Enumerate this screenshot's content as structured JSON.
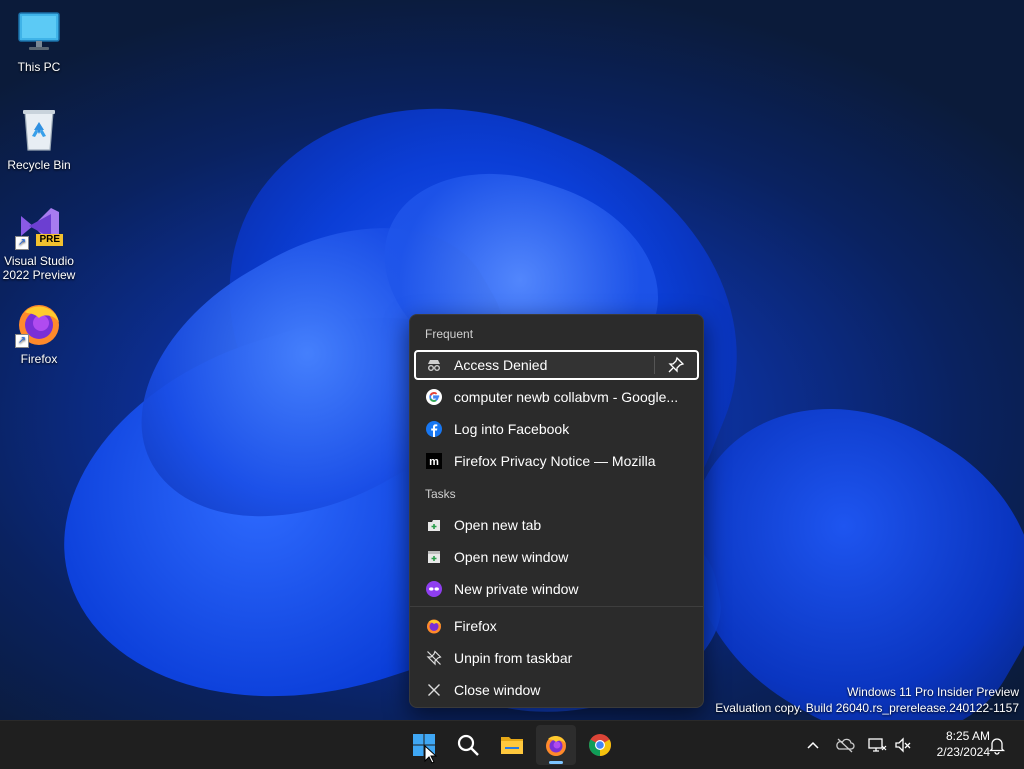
{
  "desktop": {
    "icons": [
      {
        "label": "This PC",
        "icon": "monitor-icon"
      },
      {
        "label": "Recycle Bin",
        "icon": "recycle-bin-icon"
      },
      {
        "label": "Visual Studio 2022 Preview",
        "label_line1": "Visual Studio",
        "label_line2": "2022 Preview",
        "badge": "PRE",
        "icon": "visual-studio-icon"
      },
      {
        "label": "Firefox",
        "icon": "firefox-icon"
      }
    ],
    "watermark": {
      "line1": "Windows 11 Pro Insider Preview",
      "line2": "Evaluation copy. Build 26040.rs_prerelease.240122-1157"
    }
  },
  "jumplist": {
    "frequent_header": "Frequent",
    "frequent": [
      {
        "label": "Access Denied",
        "icon": "spy-icon",
        "selected": true
      },
      {
        "label": "computer newb collabvm - Google...",
        "icon": "google-icon"
      },
      {
        "label": "Log into Facebook",
        "icon": "facebook-icon"
      },
      {
        "label": "Firefox Privacy Notice — Mozilla",
        "icon": "mozilla-icon"
      }
    ],
    "tasks_header": "Tasks",
    "tasks": [
      {
        "label": "Open new tab",
        "icon": "new-tab-icon"
      },
      {
        "label": "Open new window",
        "icon": "new-window-icon"
      },
      {
        "label": "New private window",
        "icon": "private-window-icon"
      }
    ],
    "app_actions": [
      {
        "label": "Firefox",
        "icon": "firefox-icon"
      },
      {
        "label": "Unpin from taskbar",
        "icon": "unpin-icon"
      },
      {
        "label": "Close window",
        "icon": "close-icon"
      }
    ]
  },
  "taskbar": {
    "apps": [
      "start-icon",
      "search-icon",
      "file-explorer-icon",
      "firefox-icon",
      "chrome-icon"
    ],
    "active_app": "firefox-icon",
    "clock": {
      "time": "8:25 AM",
      "date": "2/23/2024"
    },
    "tray": [
      "chevron-up-icon",
      "onedrive-icon",
      "network-icon",
      "volume-muted-icon",
      "notification-bell-icon"
    ]
  },
  "colors": {
    "accent": "#7cc4ff",
    "menu_bg": "#2b2b2b",
    "taskbar_bg": "#1f1f1f"
  }
}
